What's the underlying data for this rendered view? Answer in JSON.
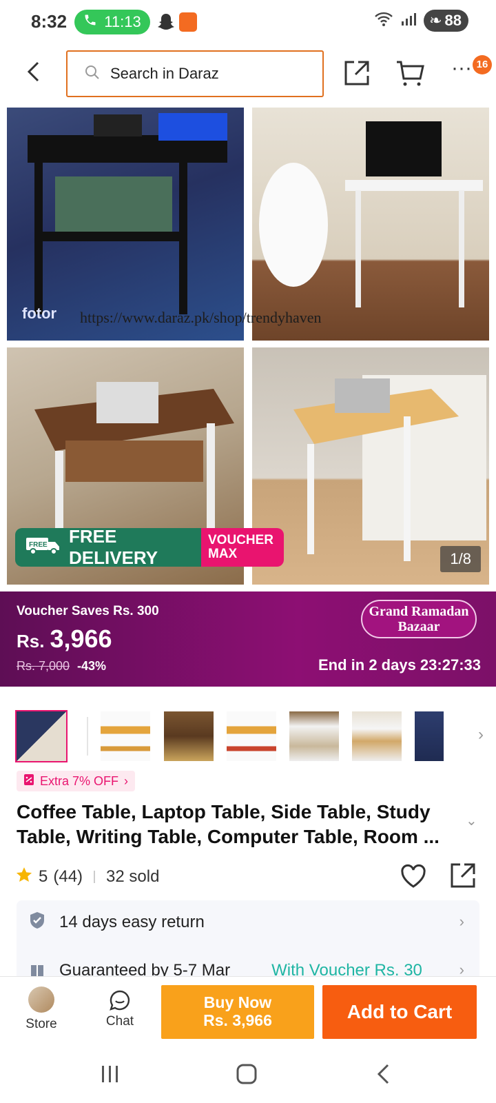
{
  "status_bar": {
    "time": "8:32",
    "call_timer": "11:13",
    "battery": "88"
  },
  "nav": {
    "search_placeholder": "Search in Daraz",
    "cart_badge": "16"
  },
  "hero": {
    "watermark_url": "https://www.daraz.pk/shop/trendyhaven",
    "watermark_brand": "fotor",
    "free_delivery_tag": "FREE",
    "free_delivery_label": "FREE DELIVERY",
    "voucher_line1": "VOUCHER",
    "voucher_line2": "MAX",
    "image_counter": "1/8"
  },
  "price": {
    "voucher_saves": "Voucher Saves Rs. 300",
    "currency": "Rs.",
    "amount": "3,966",
    "original": "Rs. 7,000",
    "discount": "-43%",
    "campaign_line1": "Grand Ramadan",
    "campaign_line2": "Bazaar",
    "ends_in": "End in 2 days 23:27:33"
  },
  "product": {
    "extra_off": "Extra 7% OFF",
    "title": "Coffee Table, Laptop Table, Side Table, Study Table, Writing Table, Computer Table, Room ...",
    "rating": "5",
    "reviews": "(44)",
    "sold": "32 sold"
  },
  "services": {
    "returns": "14 days easy return",
    "guarantee": "Guaranteed by 5-7 Mar",
    "guarantee_voucher": "With Voucher Rs. 30"
  },
  "bottom_bar": {
    "store_label": "Store",
    "chat_label": "Chat",
    "buy_now_label": "Buy Now",
    "buy_now_price": "Rs. 3,966",
    "add_to_cart_label": "Add to Cart"
  },
  "colors": {
    "brand_orange": "#f75d10",
    "buy_now": "#f9a11b",
    "campaign_purple": "#7c1068",
    "voucher_pink": "#e9146f"
  }
}
